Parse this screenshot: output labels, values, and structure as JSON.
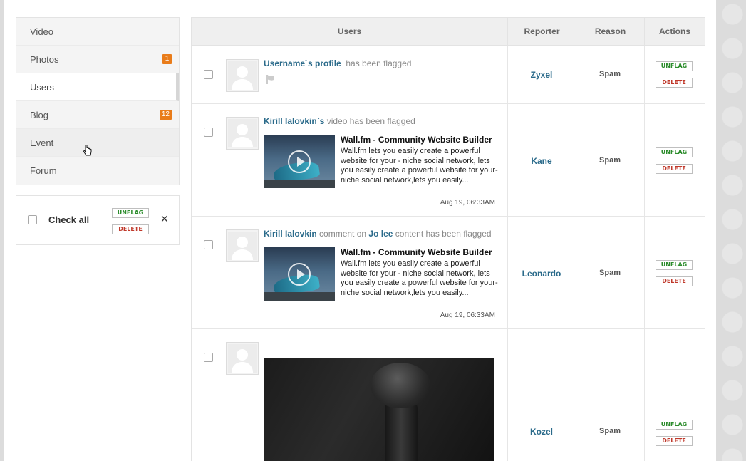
{
  "sidebar": {
    "items": [
      {
        "label": "Video",
        "badge": ""
      },
      {
        "label": "Photos",
        "badge": "1"
      },
      {
        "label": "Users",
        "badge": ""
      },
      {
        "label": "Blog",
        "badge": "12"
      },
      {
        "label": "Event",
        "badge": ""
      },
      {
        "label": "Forum",
        "badge": ""
      }
    ],
    "active": "Users"
  },
  "bulk": {
    "check_all_label": "Check all",
    "unflag_label": "UNFLAG",
    "delete_label": "DELETE",
    "close_label": "✕"
  },
  "table": {
    "headers": [
      "Users",
      "Reporter",
      "Reason",
      "Actions"
    ],
    "rows": [
      {
        "actor": "Username`s profile",
        "flag_text": "has been flagged",
        "reporter": "Zyxel",
        "reason": "Spam"
      },
      {
        "actor": "Kirill Ialovkin`s",
        "flag_text": "video has been flagged",
        "card_title": "Wall.fm - Community Website Builder",
        "card_desc": "Wall.fm lets you easily create a powerful website for your - niche social network,  lets you easily create a powerful website for your- niche social network,lets you easily...",
        "date": "Aug 19, 06:33AM",
        "reporter": "Kane",
        "reason": "Spam"
      },
      {
        "actor": "Kirill Ialovkin",
        "mid_text": "comment on",
        "target": "Jo lee",
        "flag_text": "content has been flagged",
        "card_title": "Wall.fm - Community Website Builder",
        "card_desc": "Wall.fm lets you easily create a powerful website for your - niche social network,  lets you easily create a powerful website for your- niche social network,lets you easily...",
        "date": "Aug 19, 06:33AM",
        "reporter": "Leonardo",
        "reason": "Spam"
      },
      {
        "reporter": "Kozel",
        "reason": "Spam"
      }
    ],
    "unflag_label": "UNFLAG",
    "delete_label": "DELETE"
  },
  "colors": {
    "badge": "#e97c1a",
    "link": "#2a6a8a",
    "unflag": "#2c8c2c",
    "delete": "#c0392b"
  }
}
